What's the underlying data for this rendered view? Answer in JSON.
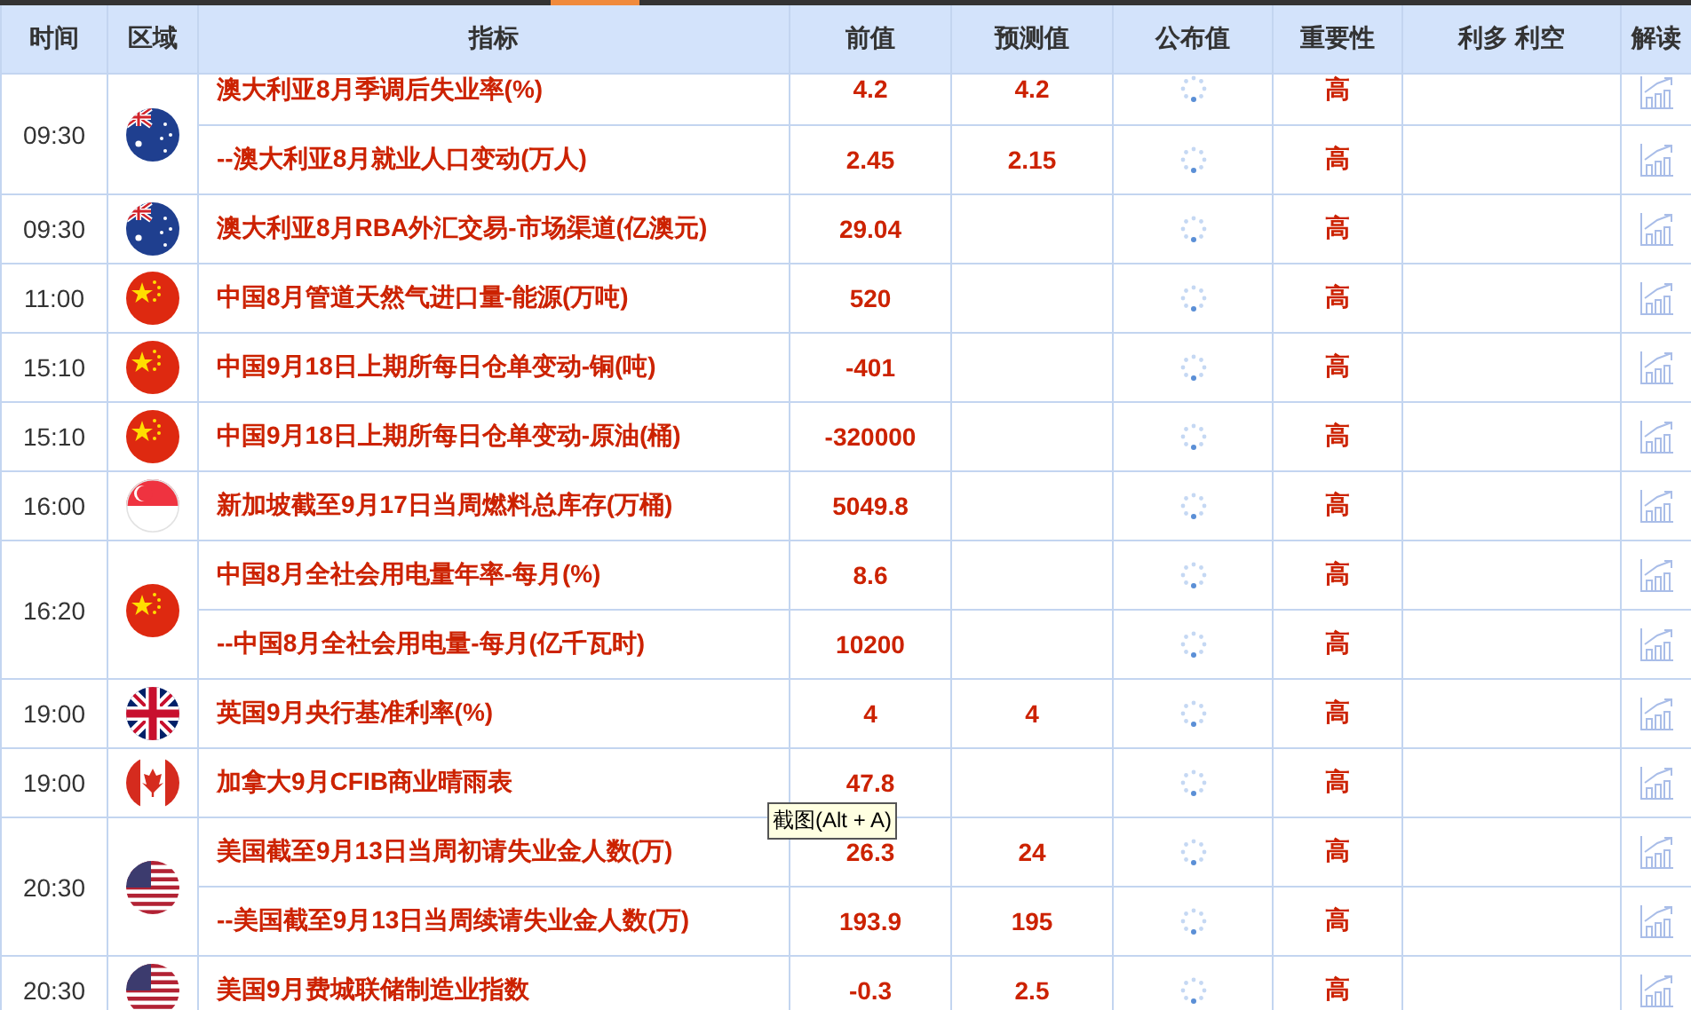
{
  "columns": [
    "时间",
    "区域",
    "指标",
    "前值",
    "预测值",
    "公布值",
    "重要性",
    "利多 利空",
    "解读"
  ],
  "groups": [
    {
      "time": "09:30",
      "kind": "australia",
      "events": [
        {
          "name": "澳大利亚8月季调后失业率(%)",
          "previous": "4.2",
          "forecast": "4.2",
          "importance": "高"
        },
        {
          "name": "--澳大利亚8月就业人口变动(万人)",
          "previous": "2.45",
          "forecast": "2.15",
          "importance": "高"
        }
      ]
    },
    {
      "time": "09:30",
      "kind": "australia",
      "events": [
        {
          "name": "澳大利亚8月RBA外汇交易-市场渠道(亿澳元)",
          "previous": "29.04",
          "importance": "高"
        }
      ]
    },
    {
      "time": "11:00",
      "kind": "china",
      "events": [
        {
          "name": "中国8月管道天然气进口量-能源(万吨)",
          "previous": "520",
          "importance": "高"
        }
      ]
    },
    {
      "time": "15:10",
      "kind": "china",
      "events": [
        {
          "name": "中国9月18日上期所每日仓单变动-铜(吨)",
          "previous": "-401",
          "importance": "高"
        }
      ]
    },
    {
      "time": "15:10",
      "kind": "china",
      "events": [
        {
          "name": "中国9月18日上期所每日仓单变动-原油(桶)",
          "previous": "-320000",
          "importance": "高"
        }
      ]
    },
    {
      "time": "16:00",
      "kind": "singapore",
      "events": [
        {
          "name": "新加坡截至9月17日当周燃料总库存(万桶)",
          "previous": "5049.8",
          "importance": "高"
        }
      ]
    },
    {
      "time": "16:20",
      "kind": "china",
      "events": [
        {
          "name": "中国8月全社会用电量年率-每月(%)",
          "previous": "8.6",
          "importance": "高"
        },
        {
          "name": "--中国8月全社会用电量-每月(亿千瓦时)",
          "previous": "10200",
          "importance": "高"
        }
      ]
    },
    {
      "time": "19:00",
      "kind": "uk",
      "events": [
        {
          "name": "英国9月央行基准利率(%)",
          "previous": "4",
          "forecast": "4",
          "importance": "高"
        }
      ]
    },
    {
      "time": "19:00",
      "kind": "canada",
      "events": [
        {
          "name": "加拿大9月CFIB商业晴雨表",
          "previous": "47.8",
          "importance": "高"
        }
      ]
    },
    {
      "time": "20:30",
      "kind": "usa",
      "events": [
        {
          "name": "美国截至9月13日当周初请失业金人数(万)",
          "previous": "26.3",
          "forecast": "24",
          "importance": "高"
        },
        {
          "name": "--美国截至9月13日当周续请失业金人数(万)",
          "previous": "193.9",
          "forecast": "195",
          "importance": "高"
        }
      ]
    },
    {
      "time": "20:30",
      "kind": "usa",
      "events": [
        {
          "name": "美国9月费城联储制造业指数",
          "previous": "-0.3",
          "forecast": "2.5",
          "importance": "高"
        }
      ]
    }
  ],
  "tooltip": "截图(Alt + A)"
}
